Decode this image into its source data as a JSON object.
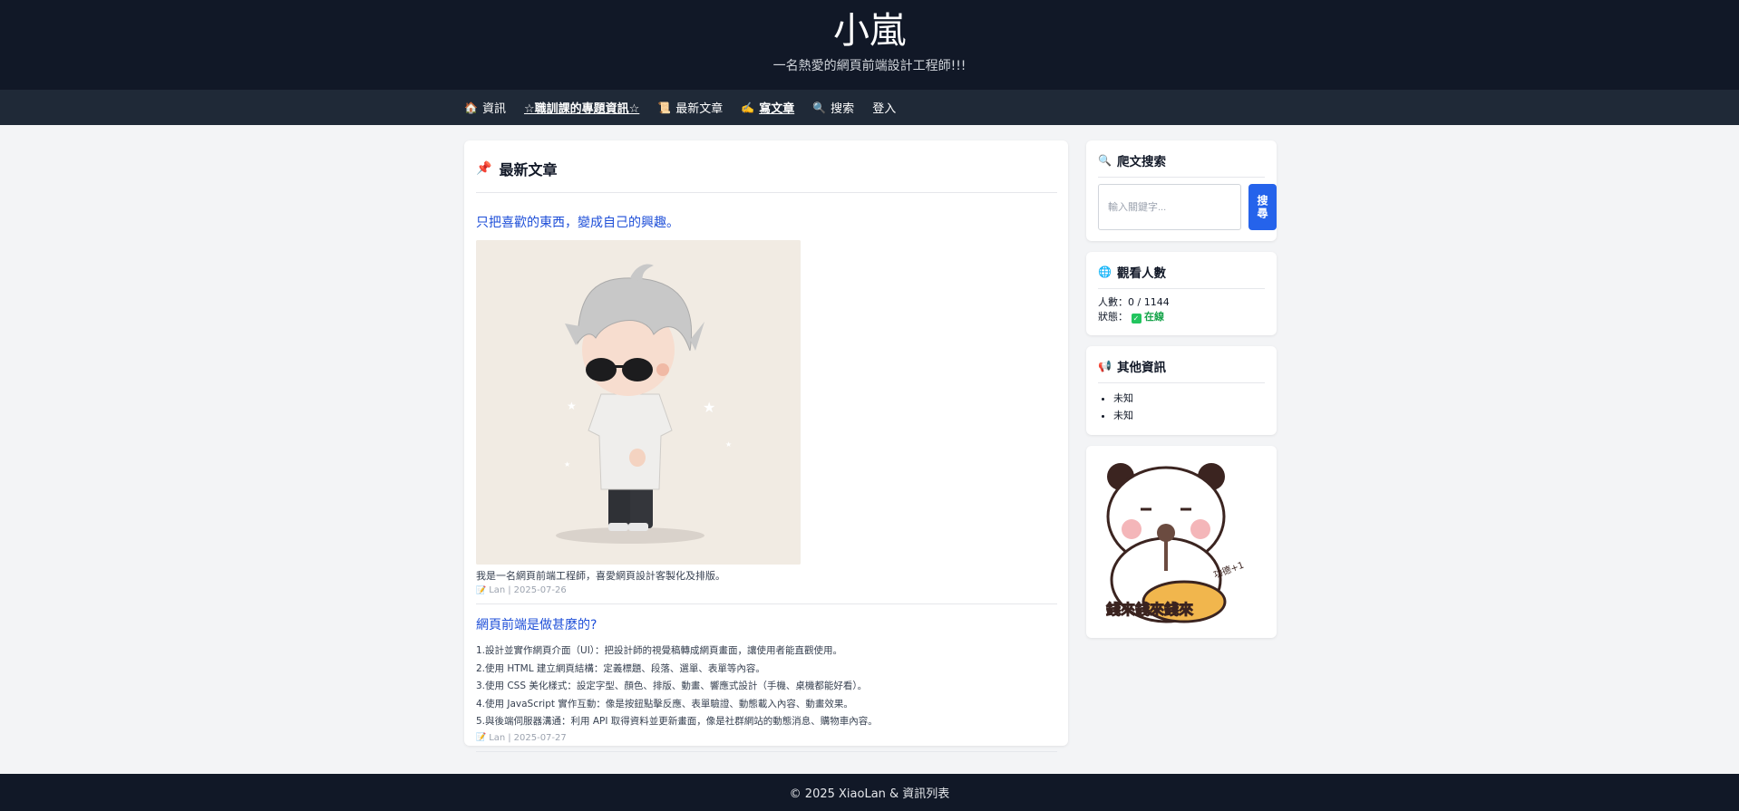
{
  "header": {
    "title": "小嵐",
    "subtitle": "一名熱愛的網頁前端設計工程師!!!"
  },
  "nav": {
    "items": [
      {
        "icon": "house-icon",
        "label": "資訊"
      },
      {
        "label": "☆職訓課的專題資訊☆"
      },
      {
        "icon": "scroll-icon",
        "label": "最新文章"
      },
      {
        "icon": "writing-hand-icon",
        "label": "寫文章"
      },
      {
        "icon": "search-icon",
        "label": "搜索"
      },
      {
        "label": "登入"
      }
    ]
  },
  "main": {
    "heading": "最新文章",
    "articles": [
      {
        "title": "只把喜歡的東西，變成自己的興趣。",
        "excerpt": "我是一名網頁前端工程師，喜愛網頁設計客製化及排版。",
        "author": "Lan",
        "date": "2025-07-26"
      },
      {
        "title": "網頁前端是做甚麼的?",
        "lines": [
          "1.設計並實作網頁介面（UI）：把設計師的視覺稿轉成網頁畫面，讓使用者能直觀使用。",
          "2.使用 HTML 建立網頁結構：定義標題、段落、選單、表單等內容。",
          "3.使用 CSS 美化樣式：設定字型、顏色、排版、動畫、響應式設計（手機、桌機都能好看）。",
          "4.使用 JavaScript 實作互動：像是按鈕點擊反應、表單驗證、動態載入內容、動畫效果。",
          "5.與後端伺服器溝通：利用 API 取得資料並更新畫面，像是社群網站的動態消息、購物車內容。"
        ],
        "author": "Lan",
        "date": "2025-07-27"
      }
    ]
  },
  "sidebar": {
    "search": {
      "heading": "爬文搜索",
      "placeholder": "輸入關鍵字...",
      "button": "搜尋"
    },
    "viewers": {
      "heading": "觀看人數",
      "count_label": "人數：",
      "count_value": "0 / 1144",
      "status_label": "狀態：",
      "status_value": "在線"
    },
    "other": {
      "heading": "其他資訊",
      "items": [
        "未知",
        "未知"
      ]
    },
    "sticker": {
      "text": "錢來錢來錢來",
      "badge": "功德+1"
    }
  },
  "footer": {
    "text": "© 2025 XiaoLan & 資訊列表"
  },
  "colors": {
    "header_bg": "#111827",
    "nav_bg": "#1f2937",
    "link": "#1d4ed8",
    "button": "#2563eb",
    "online": "#16a34a"
  }
}
